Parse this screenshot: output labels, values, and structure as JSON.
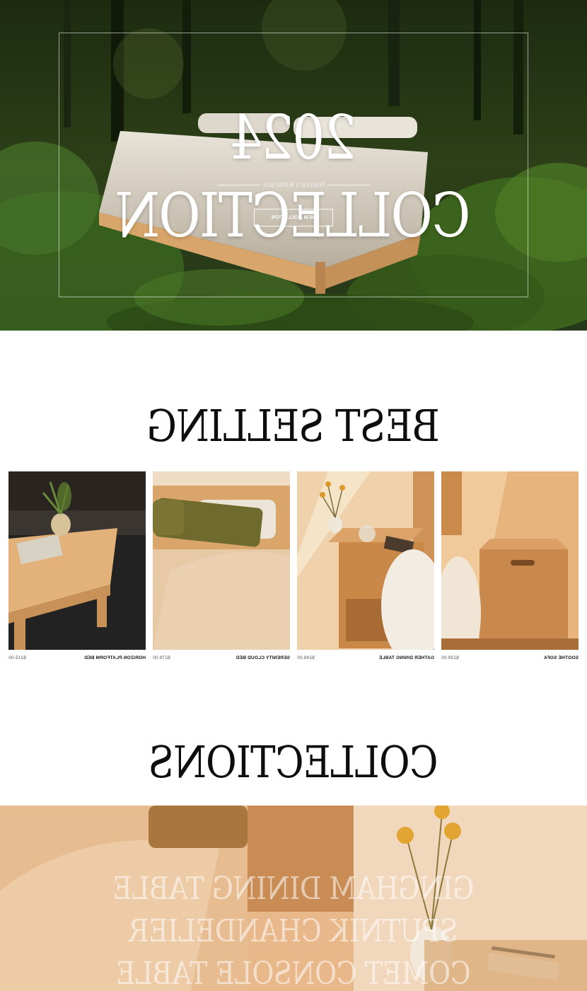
{
  "hero": {
    "title": "2024 COLLECTION",
    "subtitle": "Nature's Embrace",
    "button_label": "NEW COLLETION"
  },
  "best_selling": {
    "title": "BEST SELLING",
    "products": [
      {
        "name": "SOOTHE SOFA",
        "price": "$239.00"
      },
      {
        "name": "GATHER DINING TABLE",
        "price": "$249.00"
      },
      {
        "name": "SERENITY CLOUD BED",
        "price": "$279.00"
      },
      {
        "name": "HORIZON PLATFORM BED",
        "price": "$215.00"
      }
    ]
  },
  "collections": {
    "title": "COLLECTIONS",
    "links": [
      "GINGHAM DINING TABLE",
      "SPUTNIK CHANDELIER",
      "COMET CONSOLE TABLE"
    ]
  },
  "colors": {
    "forest_dark": "#1f2c14",
    "fern_green": "#3d5a22",
    "oak_wood": "#d9a86a",
    "linen": "#f0e6d6",
    "banner_peach": "#e9b88a"
  }
}
